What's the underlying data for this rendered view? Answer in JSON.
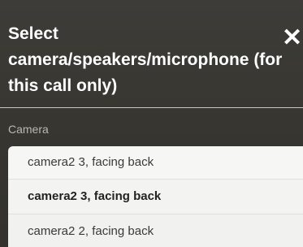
{
  "dialog": {
    "title": "Select camera/speakers/microphone (for this call only)",
    "close_label": "✕"
  },
  "camera": {
    "label": "Camera",
    "options": [
      "camera2 3, facing back",
      "camera2 3, facing back",
      "camera2 2, facing back"
    ],
    "selected_index": 1
  }
}
